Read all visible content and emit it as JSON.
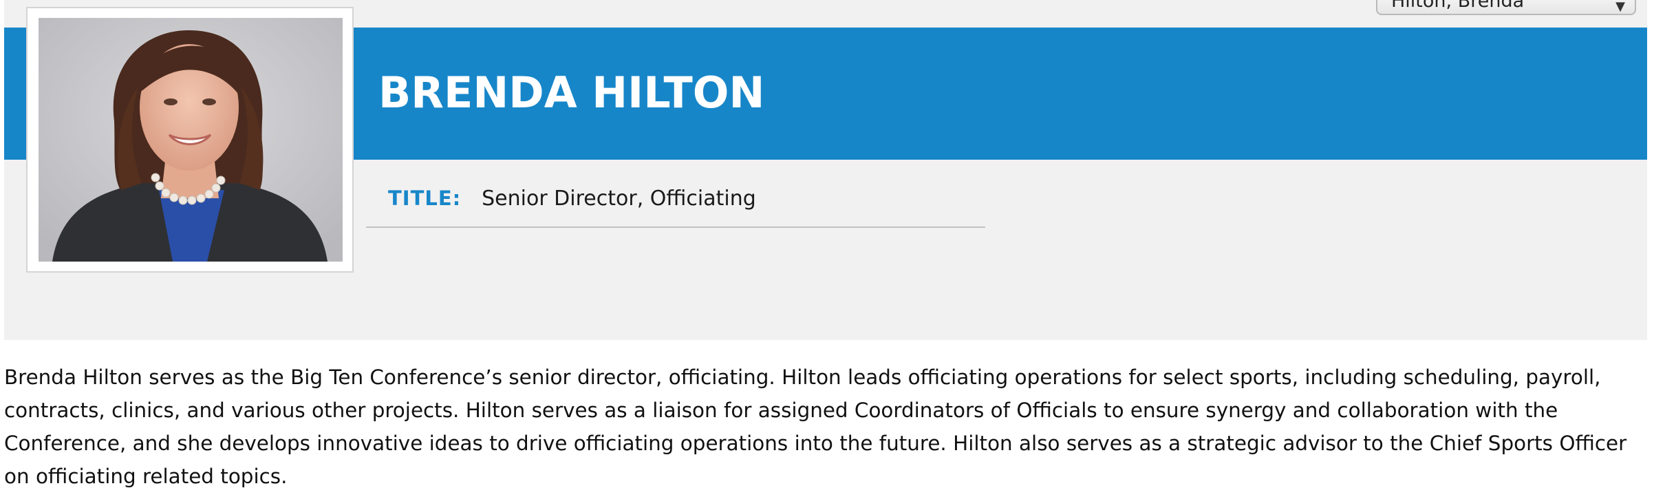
{
  "staff_select": {
    "selected": "Hilton, Brenda"
  },
  "profile": {
    "name": "BRENDA HILTON",
    "title_label": "TITLE:",
    "title_value": "Senior Director, Officiating",
    "photo_icon": "portrait-photo"
  },
  "bio": {
    "text": "Brenda Hilton serves as the Big Ten Conference’s senior director, officiating. Hilton leads officiating operations for select sports, including scheduling, payroll, contracts, clinics, and various other projects. Hilton serves as a liaison for assigned Coordinators of Officials to ensure synergy and collaboration with the Conference, and she develops innovative ideas to drive officiating operations into the future. Hilton also serves as a strategic advisor to the Chief Sports Officer on officiating related topics."
  },
  "colors": {
    "accent": "#1786c9",
    "panel": "#f1f1f1"
  }
}
